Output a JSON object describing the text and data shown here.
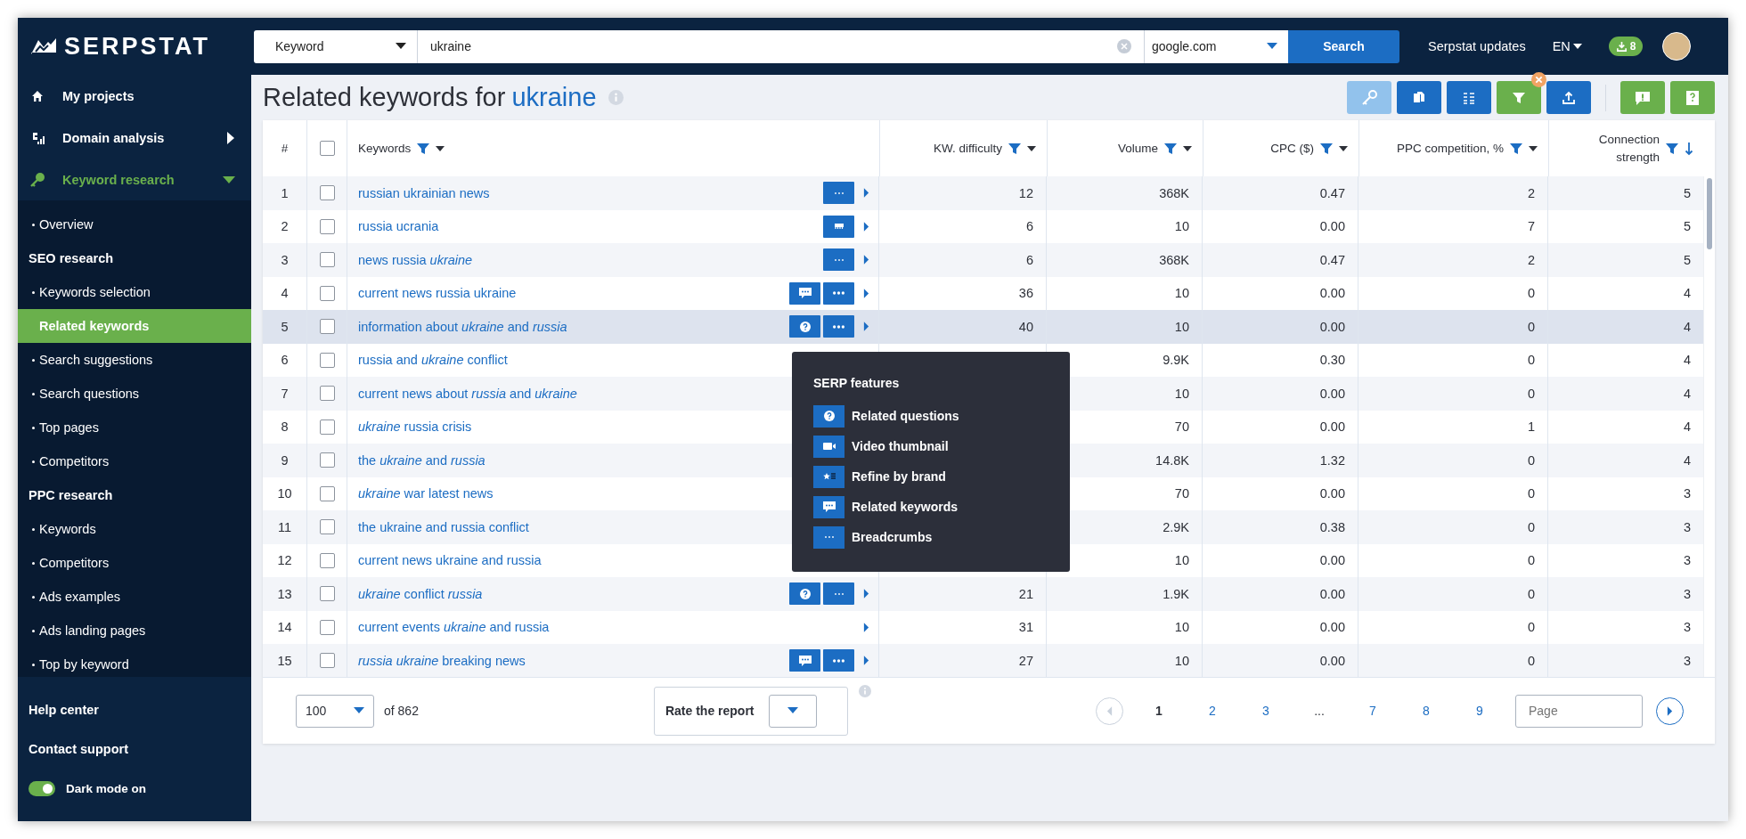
{
  "brand": {
    "name": "SERPSTAT"
  },
  "sidebar": {
    "nav": [
      {
        "label": "My projects",
        "kind": "link",
        "selected": false
      },
      {
        "label": "Domain analysis",
        "kind": "group",
        "expanded": false,
        "selected": false
      },
      {
        "label": "Keyword research",
        "kind": "group",
        "expanded": true,
        "selected": true
      }
    ],
    "subnav": [
      {
        "kind": "item",
        "label": "Overview",
        "selected": false
      },
      {
        "kind": "heading",
        "label": "SEO research"
      },
      {
        "kind": "item",
        "label": "Keywords selection",
        "selected": false
      },
      {
        "kind": "item",
        "label": "Related keywords",
        "selected": true
      },
      {
        "kind": "item",
        "label": "Search suggestions",
        "selected": false
      },
      {
        "kind": "item",
        "label": "Search questions",
        "selected": false
      },
      {
        "kind": "item",
        "label": "Top pages",
        "selected": false
      },
      {
        "kind": "item",
        "label": "Competitors",
        "selected": false
      },
      {
        "kind": "heading",
        "label": "PPC research"
      },
      {
        "kind": "item",
        "label": "Keywords",
        "selected": false
      },
      {
        "kind": "item",
        "label": "Competitors",
        "selected": false
      },
      {
        "kind": "item",
        "label": "Ads examples",
        "selected": false
      },
      {
        "kind": "item",
        "label": "Ads landing pages",
        "selected": false
      },
      {
        "kind": "item",
        "label": "Top by keyword",
        "selected": false
      }
    ],
    "links": [
      "Help center",
      "Contact support"
    ],
    "dark_mode": {
      "label": "Dark mode on",
      "on": true
    }
  },
  "topbar": {
    "search_type": "Keyword",
    "query": "ukraine",
    "engine": "google.com",
    "search_button": "Search",
    "updates": "Serpstat updates",
    "language": "EN",
    "downloads_badge": "8"
  },
  "page": {
    "title": "Related keywords for",
    "query": "ukraine"
  },
  "toolbar": [
    {
      "kind": "key",
      "disabled": true,
      "active": false
    },
    {
      "kind": "copy",
      "disabled": false,
      "active": false
    },
    {
      "kind": "columns",
      "disabled": false,
      "active": false
    },
    {
      "kind": "filter",
      "disabled": false,
      "active": true
    },
    {
      "kind": "export",
      "disabled": false,
      "active": false
    },
    {
      "kind": "feedback",
      "disabled": false,
      "active": false
    },
    {
      "kind": "help",
      "disabled": false,
      "active": false
    }
  ],
  "table": {
    "columns": [
      {
        "kind": "index",
        "label": "#"
      },
      {
        "kind": "select",
        "checked": false
      },
      {
        "kind": "keyword",
        "label": "Keywords",
        "sorted": false
      },
      {
        "kind": "number",
        "label": "KW. difficulty",
        "sorted": false
      },
      {
        "kind": "number",
        "label": "Volume",
        "sorted": false
      },
      {
        "kind": "number",
        "label": "CPC ($)",
        "sorted": false
      },
      {
        "kind": "number",
        "label": "PPC competition, %",
        "sorted": false
      },
      {
        "kind": "number",
        "label": "Connection strength",
        "sorted": true
      }
    ],
    "rows": [
      {
        "index": "1",
        "checked": false,
        "highlighted": false,
        "keyword": "russian ukrainian news",
        "features": [
          {
            "kind": "breadcrumbs"
          }
        ],
        "kw_difficulty": "12",
        "volume": "368K",
        "cpc": "0.47",
        "ppc_competition": "2",
        "connection_strength": "5"
      },
      {
        "index": "2",
        "checked": false,
        "highlighted": false,
        "keyword": "russia ucrania",
        "features": [
          {
            "kind": "carousel"
          }
        ],
        "kw_difficulty": "6",
        "volume": "10",
        "cpc": "0.00",
        "ppc_competition": "7",
        "connection_strength": "5"
      },
      {
        "index": "3",
        "checked": false,
        "highlighted": false,
        "keyword": "news russia *ukraine*",
        "features": [
          {
            "kind": "breadcrumbs"
          }
        ],
        "kw_difficulty": "6",
        "volume": "368K",
        "cpc": "0.47",
        "ppc_competition": "2",
        "connection_strength": "5"
      },
      {
        "index": "4",
        "checked": false,
        "highlighted": false,
        "keyword": "current news russia ukraine",
        "features": [
          {
            "kind": "related_keywords"
          },
          {
            "kind": "more"
          }
        ],
        "kw_difficulty": "36",
        "volume": "10",
        "cpc": "0.00",
        "ppc_competition": "0",
        "connection_strength": "4"
      },
      {
        "index": "5",
        "checked": false,
        "highlighted": true,
        "keyword": "information about *ukraine* and *russia*",
        "features": [
          {
            "kind": "related_questions"
          },
          {
            "kind": "more"
          }
        ],
        "kw_difficulty": "40",
        "volume": "10",
        "cpc": "0.00",
        "ppc_competition": "0",
        "connection_strength": "4"
      },
      {
        "index": "6",
        "checked": false,
        "highlighted": false,
        "keyword": "russia and *ukraine* conflict",
        "features": [],
        "volume": "9.9K",
        "cpc": "0.30",
        "ppc_competition": "0",
        "connection_strength": "4"
      },
      {
        "index": "7",
        "checked": false,
        "highlighted": false,
        "keyword": "current news about *russia* and *ukraine*",
        "features": [],
        "volume": "10",
        "cpc": "0.00",
        "ppc_competition": "0",
        "connection_strength": "4"
      },
      {
        "index": "8",
        "checked": false,
        "highlighted": false,
        "keyword": "*ukraine* russia crisis",
        "features": [],
        "volume": "70",
        "cpc": "0.00",
        "ppc_competition": "1",
        "connection_strength": "4"
      },
      {
        "index": "9",
        "checked": false,
        "highlighted": false,
        "keyword": "the *ukraine* and *russia*",
        "features": [],
        "volume": "14.8K",
        "cpc": "1.32",
        "ppc_competition": "0",
        "connection_strength": "4"
      },
      {
        "index": "10",
        "checked": false,
        "highlighted": false,
        "keyword": "*ukraine* war latest news",
        "features": [],
        "volume": "70",
        "cpc": "0.00",
        "ppc_competition": "0",
        "connection_strength": "3"
      },
      {
        "index": "11",
        "checked": false,
        "highlighted": false,
        "keyword": "the ukraine and russia conflict",
        "features": [],
        "volume": "2.9K",
        "cpc": "0.38",
        "ppc_competition": "0",
        "connection_strength": "3"
      },
      {
        "index": "12",
        "checked": false,
        "highlighted": false,
        "keyword": "current news ukraine and russia",
        "features": [],
        "volume": "10",
        "cpc": "0.00",
        "ppc_competition": "0",
        "connection_strength": "3"
      },
      {
        "index": "13",
        "checked": false,
        "highlighted": false,
        "keyword": "*ukraine* conflict *russia*",
        "features": [
          {
            "kind": "related_questions"
          },
          {
            "kind": "breadcrumbs"
          }
        ],
        "kw_difficulty": "21",
        "volume": "1.9K",
        "cpc": "0.00",
        "ppc_competition": "0",
        "connection_strength": "3"
      },
      {
        "index": "14",
        "checked": false,
        "highlighted": false,
        "keyword": "current events *ukraine* and russia",
        "features": [],
        "kw_difficulty": "31",
        "volume": "10",
        "cpc": "0.00",
        "ppc_competition": "0",
        "connection_strength": "3"
      },
      {
        "index": "15",
        "checked": false,
        "highlighted": false,
        "keyword": "*russia ukraine* breaking news",
        "features": [
          {
            "kind": "related_keywords"
          },
          {
            "kind": "more"
          }
        ],
        "kw_difficulty": "27",
        "volume": "10",
        "cpc": "0.00",
        "ppc_competition": "0",
        "connection_strength": "3"
      }
    ]
  },
  "tooltip": {
    "title": "SERP features",
    "items": [
      {
        "kind": "related_questions",
        "label": "Related questions"
      },
      {
        "kind": "video",
        "label": "Video thumbnail"
      },
      {
        "kind": "refine_by_brand",
        "label": "Refine by brand"
      },
      {
        "kind": "related_keywords",
        "label": "Related keywords"
      },
      {
        "kind": "breadcrumbs",
        "label": "Breadcrumbs"
      }
    ]
  },
  "footer": {
    "per_page": "100",
    "total": "of 862",
    "rate_label": "Rate the report",
    "prev_disabled": true,
    "pages": [
      {
        "label": "1",
        "kind": "page",
        "selected": true
      },
      {
        "label": "2",
        "kind": "page",
        "selected": false
      },
      {
        "label": "3",
        "kind": "page",
        "selected": false
      },
      {
        "label": "...",
        "kind": "gap"
      },
      {
        "label": "7",
        "kind": "page",
        "selected": false
      },
      {
        "label": "8",
        "kind": "page",
        "selected": false
      },
      {
        "label": "9",
        "kind": "page",
        "selected": false
      }
    ],
    "page_placeholder": "Page"
  }
}
